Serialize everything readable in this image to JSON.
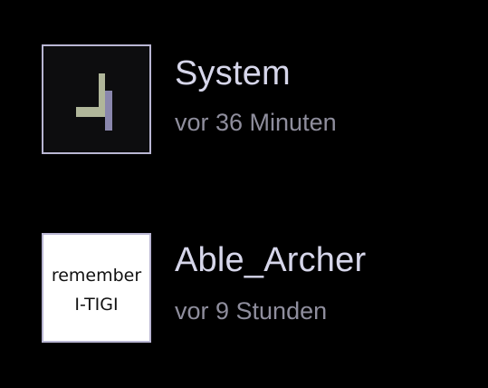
{
  "conversations": [
    {
      "name": "System",
      "time": "vor 36 Minuten",
      "avatar": {
        "type": "logo",
        "icon": "system-logo-icon",
        "colors": [
          "#b0b69a",
          "#8a87ad"
        ]
      }
    },
    {
      "name": "Able_Archer",
      "time": "vor 9 Stunden",
      "avatar": {
        "type": "text-image",
        "line1": "remember",
        "line2": "I-TIGI"
      }
    }
  ]
}
